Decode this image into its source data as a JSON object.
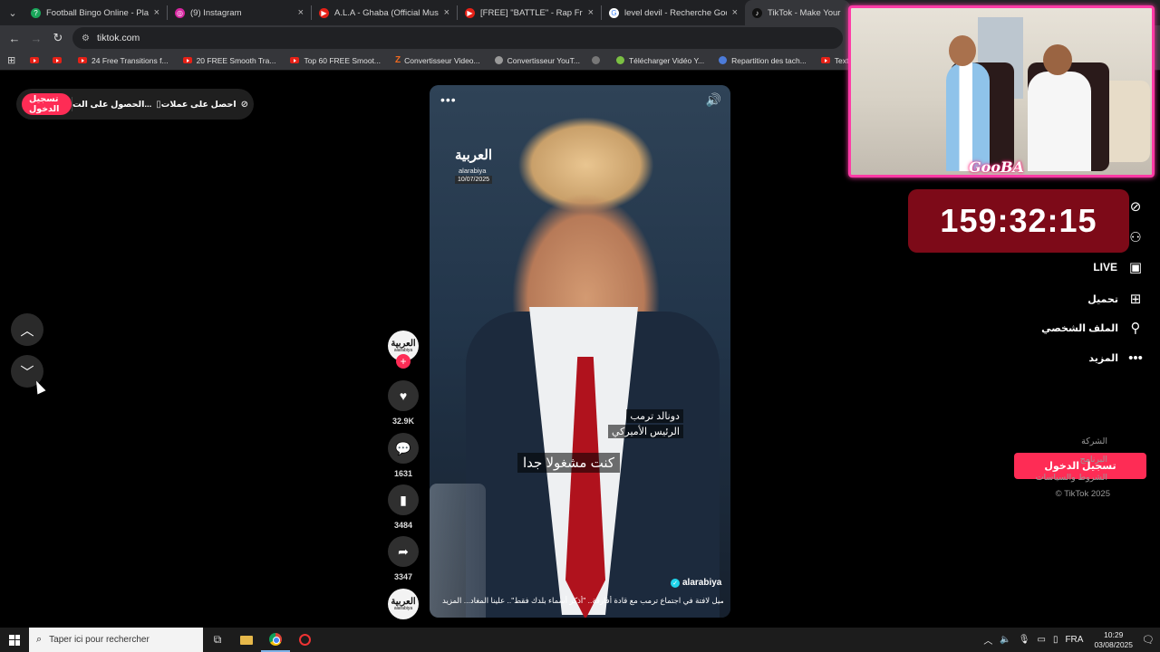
{
  "browser": {
    "tabs": [
      {
        "title": "Football Bingo Online - Play No",
        "fav": "#1aa55a",
        "glyph": "?"
      },
      {
        "title": "(9) Instagram",
        "fav": "#d6249f",
        "glyph": "◎"
      },
      {
        "title": "A.L.A - Ghaba (Official Music Vi",
        "fav": "#e62117",
        "glyph": "▶"
      },
      {
        "title": "[FREE] \"BATTLE\" - Rap Freestyle",
        "fav": "#e62117",
        "glyph": "▶"
      },
      {
        "title": "level devil - Recherche Google",
        "fav": "#ffffff",
        "glyph": "G"
      },
      {
        "title": "TikTok - Make Your Day",
        "fav": "#111111",
        "glyph": "♪"
      }
    ],
    "url": "tiktok.com",
    "bookmarks": [
      {
        "label": "",
        "icon": "yt"
      },
      {
        "label": "",
        "icon": "yt"
      },
      {
        "label": "24 Free Transitions f...",
        "icon": "yt"
      },
      {
        "label": "20 FREE Smooth Tra...",
        "icon": "yt"
      },
      {
        "label": "Top 60 FREE Smoot...",
        "icon": "yt"
      },
      {
        "label": "Convertisseur Video...",
        "icon": "z"
      },
      {
        "label": "Convertisseur YouT...",
        "icon": "gen",
        "color": "#9a9a9a"
      },
      {
        "label": "",
        "icon": "gen",
        "color": "#777777"
      },
      {
        "label": "Télécharger Vidéo Y...",
        "icon": "gen",
        "color": "#7bc043"
      },
      {
        "label": "Repartition des tach...",
        "icon": "gen",
        "color": "#4c7bd9"
      },
      {
        "label": "Text and Image ani...",
        "icon": "yt"
      }
    ]
  },
  "promo": {
    "login": "تسجيل الدخول",
    "get_app": "الحصول على الت...",
    "get_coins": "احصل على عملات"
  },
  "video": {
    "logo_ar": "العربية",
    "logo_en": "alarabiya",
    "date": "10/07/2025",
    "name_line1": "دونالد ترمب",
    "name_line2": "الرئيس الأميركي",
    "subtitle": "كنت مشغولا جدا",
    "handle": "alarabiya",
    "caption": "تفاصيل لافتة في اجتماع ترمب مع قادة أفارقة.. \"أذكر أسماء بلدك فقط\".. علينا المغاد...   المزيد"
  },
  "actions": {
    "likes": "32.9K",
    "comments": "1631",
    "saves": "3484",
    "shares": "3347"
  },
  "overlay": {
    "cam_label": "GooBA",
    "timer": "159:32:15"
  },
  "sidebar": {
    "live": "LIVE",
    "upload": "تحميل",
    "profile": "الملف الشخصي",
    "more": "المزيد",
    "login": "تسجيل الدخول",
    "footer": [
      "الشركة",
      "البرنامج",
      "الشروط والسياسات",
      "© TikTok 2025"
    ]
  },
  "taskbar": {
    "search_placeholder": "Taper ici pour rechercher",
    "lang": "FRA",
    "time": "10:29",
    "date": "03/08/2025"
  }
}
